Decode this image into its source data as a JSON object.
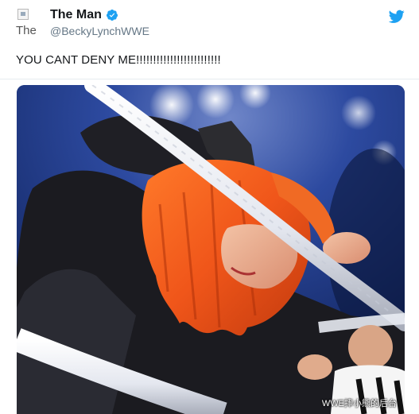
{
  "tweet": {
    "avatar_alt": "The",
    "display_name": "The Man",
    "handle": "@BeckyLynchWWE",
    "text": "YOU CANT DENY ME!!!!!!!!!!!!!!!!!!!!!!!!!",
    "verified_icon": "verified-badge-icon",
    "platform_icon": "twitter-bird-icon"
  },
  "media": {
    "watermark": "WWE摔小熊的后台"
  },
  "colors": {
    "handle": "#657786",
    "brand": "#1da1f2",
    "text": "#14171a"
  }
}
